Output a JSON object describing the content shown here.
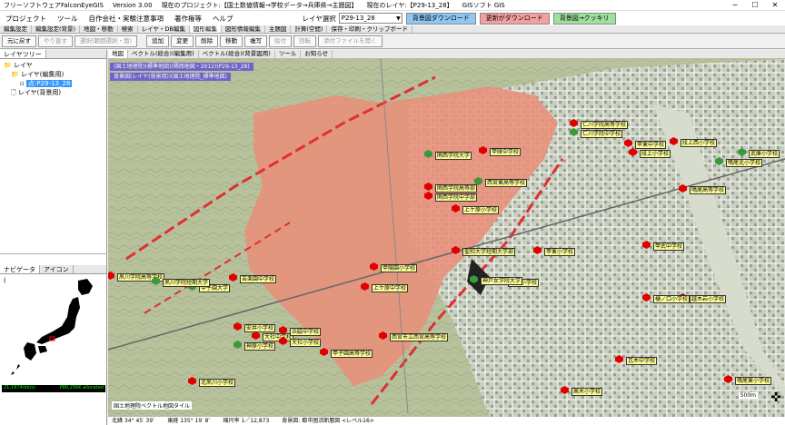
{
  "titlebar": {
    "app": "フリーソフトウェアFalconEyeGIS",
    "version": "Version 3.00",
    "project": "現在のプロジェクト:【国土数値情報→学校データ→兵庫県→主題図】",
    "layer": "現在のレイヤ:【P29-13_28】",
    "right": "GISソフト GIS"
  },
  "menu": [
    "プロジェクト",
    "ツール",
    "自作会社・実験注意事項",
    "著作権等",
    "ヘルプ"
  ],
  "layer_select": {
    "label": "レイヤ選択",
    "value": "P29-13_28"
  },
  "header_buttons": [
    {
      "label": "背景図ダウンロード",
      "color": "#8ec7f4"
    },
    {
      "label": "更新がダウンロード",
      "color": "#f5a0a0"
    },
    {
      "label": "背景図→クッキリ",
      "color": "#9ce29c"
    }
  ],
  "tabs": [
    "編集設定",
    "編集設定(背景)",
    "地図・移動",
    "検索",
    "レイヤ・DB編集",
    "図形編集",
    "図形情報編集",
    "主題図",
    "計算(空間)",
    "保存・印刷・クリップボード"
  ],
  "active_tab": 5,
  "toolbar": {
    "undo": "元に戻す",
    "redo": "やり直す",
    "select": "選択(範囲選択・面)",
    "buttons": [
      "追加",
      "変更",
      "削除",
      "移動",
      "複写",
      "貼付",
      "回転",
      "添付ファイルを開く"
    ],
    "disabled": [
      5,
      6,
      7
    ]
  },
  "left_panel": {
    "tab": "レイヤツリー",
    "tree": [
      {
        "text": "レイヤ",
        "indent": 0,
        "icon": "folder-icon"
      },
      {
        "text": "レイヤ(編集用)",
        "indent": 1,
        "icon": "folder-icon"
      },
      {
        "text": "点:P29-13_28",
        "indent": 2,
        "icon": "point-layer-icon",
        "selected": true
      },
      {
        "text": "レイヤ(背景用)",
        "indent": 1,
        "icon": "page-icon"
      }
    ],
    "nav_tabs": [
      "ナビゲータ",
      "アイコン"
    ],
    "nav_title": "(c) 国土地理院",
    "status_left": "21,1974(kb/s)",
    "status_right": "P80,256K allocated"
  },
  "map": {
    "tabs": [
      "地図",
      "ベクトル(総合)(編集用)",
      "ベクトル(総合)(背景図用)",
      "ツール",
      "お知らせ"
    ],
    "overlay1": "(国土地理院)(標準地図)(関西地図・2012)(P29-13_28)",
    "overlay2": "背景図(レイヤ(背景用))(国土地理院_標準地図)",
    "attribution": "国土地理院ベクトル地図タイル",
    "scale": "500m",
    "info": {
      "lat_label": "北緯",
      "lat": "34° 45′ 39″",
      "lon_label": "東経",
      "lon": "135° 19′ 8″",
      "scale_label": "縮尺率",
      "scale": "1／12,873",
      "bg": "背景図: 都市圏活断層図 <レベル16>"
    },
    "labels": [
      "仁川学院高等学校",
      "仁川学院中学校",
      "甲東中学校",
      "段上小学校",
      "段上西小学校",
      "関西学院大学",
      "甲陵中学校",
      "関西学院高等部",
      "関西学院中学部",
      "西宮東高等学校",
      "上ケ原小学校",
      "甲東小学校",
      "聖和大学短期大学部",
      "平木小学校",
      "甲武中学校",
      "甲陽園小学校",
      "苦楽園中学校",
      "神戸女学院大学",
      "上ケ原中学校",
      "越木岩小学校",
      "大社中学校",
      "神原小学校",
      "北夙川小学校",
      "西宮市立西宮高等学校",
      "浜脇中学校",
      "鳴尾北小学校",
      "瓦木中学校",
      "高木小学校",
      "甲子園高等学校",
      "武庫小学校",
      "樋ノ口小学校",
      "鳴尾東小学校",
      "鳴尾高等学校",
      "甲子園大学",
      "大社小学校",
      "安井小学校",
      "夙川学院高等学校",
      "夙川学院短期大学"
    ]
  },
  "colors": {
    "fault_zone": "#e8907a",
    "fault_line": "#e03030",
    "school_marker": "#e00000",
    "label_bg": "#ffff99",
    "overlay_bar": "#6a5acd"
  }
}
